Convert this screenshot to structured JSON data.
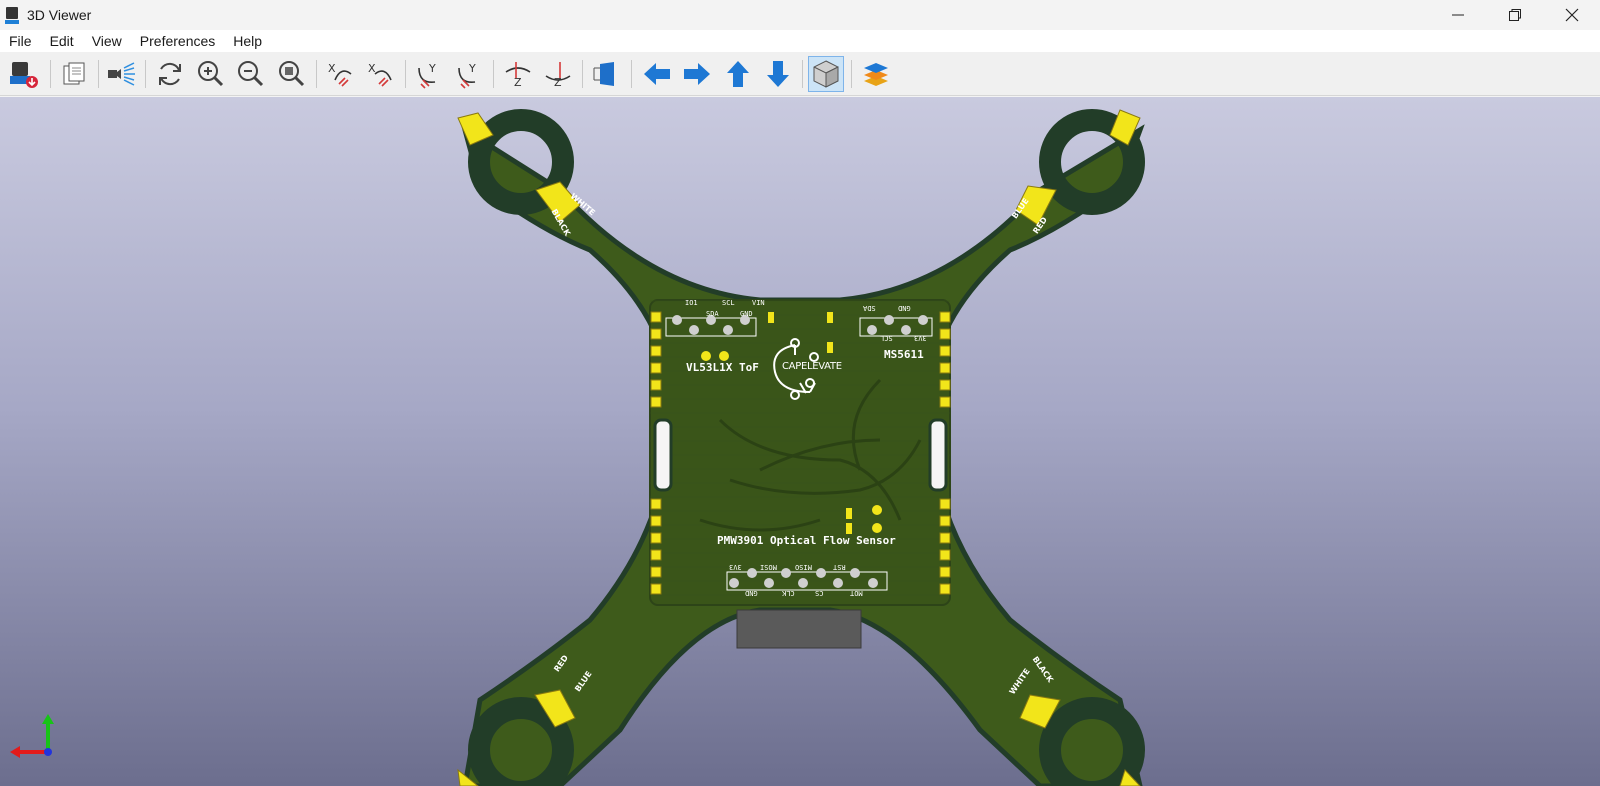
{
  "window": {
    "title": "3D Viewer",
    "minimize": "—",
    "maximize": "❐",
    "close": "✕"
  },
  "menu": [
    "File",
    "Edit",
    "View",
    "Preferences",
    "Help"
  ],
  "toolbar": [
    {
      "name": "export-image-button",
      "icon": "export-icon"
    },
    {
      "name": "copy-button",
      "icon": "copy-icon"
    },
    {
      "name": "raytracing-button",
      "icon": "raytrace-icon"
    },
    {
      "name": "reload-button",
      "icon": "refresh-icon"
    },
    {
      "name": "zoom-in-button",
      "icon": "zoom-in-icon"
    },
    {
      "name": "zoom-out-button",
      "icon": "zoom-out-icon"
    },
    {
      "name": "zoom-fit-button",
      "icon": "zoom-fit-icon"
    },
    {
      "name": "rotate-x-cw-button",
      "icon": "rotate-x-icon"
    },
    {
      "name": "rotate-x-ccw-button",
      "icon": "rotate-x-icon"
    },
    {
      "name": "rotate-y-cw-button",
      "icon": "rotate-y-icon"
    },
    {
      "name": "rotate-y-ccw-button",
      "icon": "rotate-y-icon"
    },
    {
      "name": "rotate-z-cw-button",
      "icon": "rotate-z-icon"
    },
    {
      "name": "rotate-z-ccw-button",
      "icon": "rotate-z-icon"
    },
    {
      "name": "flip-board-button",
      "icon": "flip-icon"
    },
    {
      "name": "pan-left-button",
      "icon": "arrow-left-icon"
    },
    {
      "name": "pan-right-button",
      "icon": "arrow-right-icon"
    },
    {
      "name": "pan-up-button",
      "icon": "arrow-up-icon"
    },
    {
      "name": "pan-down-button",
      "icon": "arrow-down-icon"
    },
    {
      "name": "ortho-toggle-button",
      "icon": "cube-icon"
    },
    {
      "name": "layers-button",
      "icon": "layers-icon"
    }
  ],
  "board": {
    "logo": "CAPELEVATE",
    "tof_label": "VL53L1X ToF",
    "baro_label": "MS5611",
    "flow_label": "PMW3901 Optical Flow Sensor",
    "tof_pins_top": [
      "IO1",
      "SCL",
      "VIN"
    ],
    "tof_pins_bottom": [
      "SDA",
      "GND"
    ],
    "baro_pins_top": [
      "SDA",
      "GND"
    ],
    "baro_pins_bottom": [
      "SCL",
      "3V3"
    ],
    "flow_pins_top": [
      "3V3",
      "MOSI",
      "MISO",
      "RST"
    ],
    "flow_pins_bottom": [
      "GND",
      "CLK",
      "CS",
      "MOT"
    ],
    "motor_tl": [
      "WHITE",
      "BLACK"
    ],
    "motor_tr": [
      "BLUE",
      "RED"
    ],
    "motor_bl": [
      "RED",
      "BLUE"
    ],
    "motor_br": [
      "BLACK",
      "WHITE"
    ]
  },
  "colors": {
    "pcb": "#3d5a1a",
    "silkscreen": "#ffffff",
    "pad": "#f2e51a",
    "outline": "#1f3a26"
  }
}
